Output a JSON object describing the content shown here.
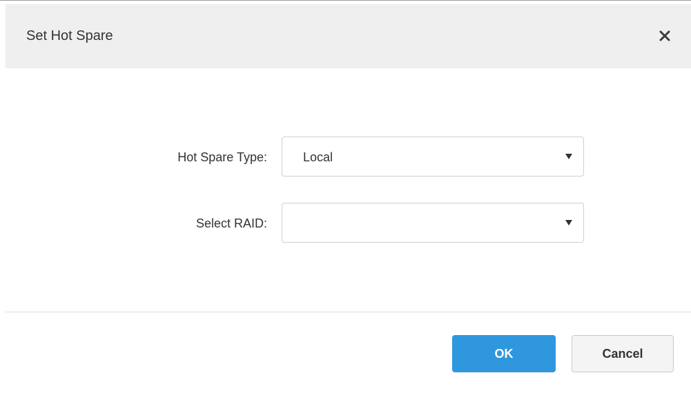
{
  "dialog": {
    "title": "Set Hot Spare",
    "close_icon": "close-icon"
  },
  "form": {
    "hot_spare_type": {
      "label": "Hot Spare Type:",
      "value": "Local"
    },
    "select_raid": {
      "label": "Select RAID:",
      "value": ""
    },
    "dropdown_icon": "triangle-down-icon"
  },
  "footer": {
    "ok_label": "OK",
    "cancel_label": "Cancel"
  },
  "colors": {
    "header_bg": "#efefef",
    "ok_button": "#2f97dd",
    "cancel_button": "#f4f4f4",
    "text": "#333333"
  }
}
